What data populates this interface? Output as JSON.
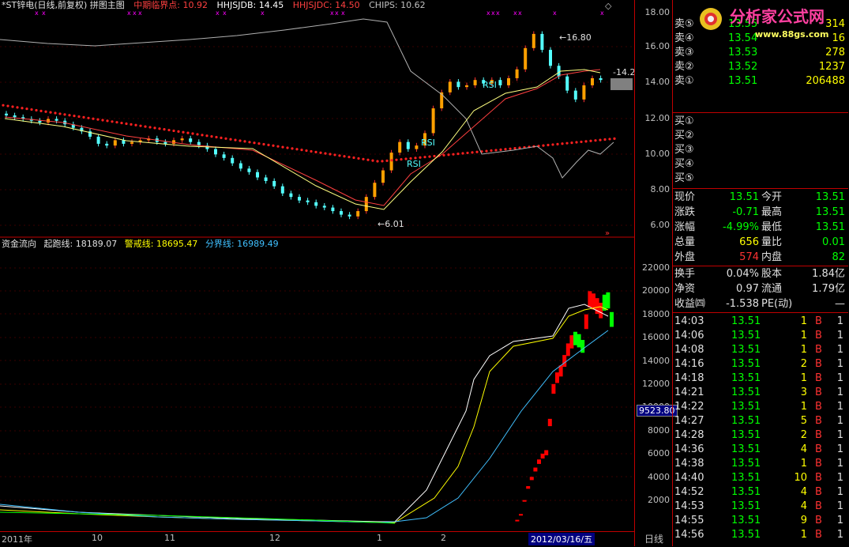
{
  "header": {
    "title": "*ST锌电(日线,前复权) 拼图主图",
    "indicators": [
      {
        "label": "中期临界点:",
        "value": "10.92",
        "color": "#ff4040"
      },
      {
        "label": "HHJSJDB:",
        "value": "14.45",
        "color": "#ffffff"
      },
      {
        "label": "HHJSJDC:",
        "value": "14.50",
        "color": "#ff4040"
      },
      {
        "label": "CHIPS:",
        "value": "10.62",
        "color": "#c0c0c0"
      }
    ]
  },
  "price_chart": {
    "annotations": {
      "high": "16.80",
      "low": "6.01",
      "last": "14.2"
    },
    "y_ticks": [
      "18.00",
      "16.00",
      "14.00",
      "12.00",
      "10.00",
      "8.00",
      "6.00"
    ],
    "rsi_labels": [
      "RSI",
      "RSI",
      "RSI"
    ]
  },
  "fund_flow": {
    "name": "资金流向",
    "lines": [
      {
        "label": "起跑线:",
        "value": "18189.07",
        "color": "#ffffff"
      },
      {
        "label": "警戒线:",
        "value": "18695.47",
        "color": "#ffff00"
      },
      {
        "label": "分界线:",
        "value": "16989.49",
        "color": "#40c0ff"
      }
    ],
    "y_ticks": [
      "22000",
      "20000",
      "18000",
      "16000",
      "14000",
      "12000",
      "10000",
      "8000",
      "6000",
      "4000",
      "2000"
    ],
    "cursor_value": "9523.80"
  },
  "x_axis": {
    "labels": [
      "2011年",
      "10",
      "11",
      "12",
      "1",
      "2"
    ],
    "cursor_date": "2012/03/16/五",
    "period_tab": "日线"
  },
  "order_book": {
    "sell": [
      {
        "label": "卖⑤",
        "price": "13.55",
        "vol": "314"
      },
      {
        "label": "卖④",
        "price": "13.54",
        "vol": "16"
      },
      {
        "label": "卖③",
        "price": "13.53",
        "vol": "278"
      },
      {
        "label": "卖②",
        "price": "13.52",
        "vol": "1237"
      },
      {
        "label": "卖①",
        "price": "13.51",
        "vol": "206488"
      }
    ],
    "buy": [
      {
        "label": "买①"
      },
      {
        "label": "买②"
      },
      {
        "label": "买③"
      },
      {
        "label": "买④"
      },
      {
        "label": "买⑤"
      }
    ]
  },
  "quote": [
    {
      "l1": "现价",
      "v1": "13.51",
      "c1": "green",
      "l2": "今开",
      "v2": "13.51",
      "c2": "green"
    },
    {
      "l1": "涨跌",
      "v1": "-0.71",
      "c1": "green",
      "l2": "最高",
      "v2": "13.51",
      "c2": "green"
    },
    {
      "l1": "涨幅",
      "v1": "-4.99%",
      "c1": "green",
      "l2": "最低",
      "v2": "13.51",
      "c2": "green"
    },
    {
      "l1": "总量",
      "v1": "656",
      "c1": "yellow",
      "l2": "量比",
      "v2": "0.01",
      "c2": "green"
    },
    {
      "l1": "外盘",
      "v1": "574",
      "c1": "red",
      "l2": "内盘",
      "v2": "82",
      "c2": "green"
    }
  ],
  "finance": [
    {
      "l1": "换手",
      "v1": "0.04%",
      "l2": "股本",
      "v2": "1.84亿"
    },
    {
      "l1": "净资",
      "v1": "0.97",
      "l2": "流通",
      "v2": "1.79亿"
    },
    {
      "l1": "收益㈣",
      "v1": "-1.538",
      "l2": "PE(动)",
      "v2": "—"
    }
  ],
  "ticks": [
    {
      "time": "14:03",
      "price": "13.51",
      "vol": "1",
      "bs": "B",
      "n": "1"
    },
    {
      "time": "14:06",
      "price": "13.51",
      "vol": "1",
      "bs": "B",
      "n": "1"
    },
    {
      "time": "14:08",
      "price": "13.51",
      "vol": "1",
      "bs": "B",
      "n": "1"
    },
    {
      "time": "14:16",
      "price": "13.51",
      "vol": "2",
      "bs": "B",
      "n": "1"
    },
    {
      "time": "14:18",
      "price": "13.51",
      "vol": "1",
      "bs": "B",
      "n": "1"
    },
    {
      "time": "14:21",
      "price": "13.51",
      "vol": "3",
      "bs": "B",
      "n": "1"
    },
    {
      "time": "14:22",
      "price": "13.51",
      "vol": "1",
      "bs": "B",
      "n": "1"
    },
    {
      "time": "14:27",
      "price": "13.51",
      "vol": "5",
      "bs": "B",
      "n": "1"
    },
    {
      "time": "14:28",
      "price": "13.51",
      "vol": "2",
      "bs": "B",
      "n": "1"
    },
    {
      "time": "14:36",
      "price": "13.51",
      "vol": "4",
      "bs": "B",
      "n": "1"
    },
    {
      "time": "14:38",
      "price": "13.51",
      "vol": "1",
      "bs": "B",
      "n": "1"
    },
    {
      "time": "14:40",
      "price": "13.51",
      "vol": "10",
      "bs": "B",
      "n": "1"
    },
    {
      "time": "14:52",
      "price": "13.51",
      "vol": "4",
      "bs": "B",
      "n": "1"
    },
    {
      "time": "14:53",
      "price": "13.51",
      "vol": "4",
      "bs": "B",
      "n": "1"
    },
    {
      "time": "14:55",
      "price": "13.51",
      "vol": "9",
      "bs": "B",
      "n": "1"
    },
    {
      "time": "14:56",
      "price": "13.51",
      "vol": "1",
      "bs": "B",
      "n": "1"
    }
  ],
  "logo": {
    "title": "分析家公式网",
    "url": "www.88gs.com"
  },
  "colors": {
    "up": "#ff3232",
    "down": "#54ffff",
    "grid": "#c00000",
    "bg": "#000000"
  }
}
